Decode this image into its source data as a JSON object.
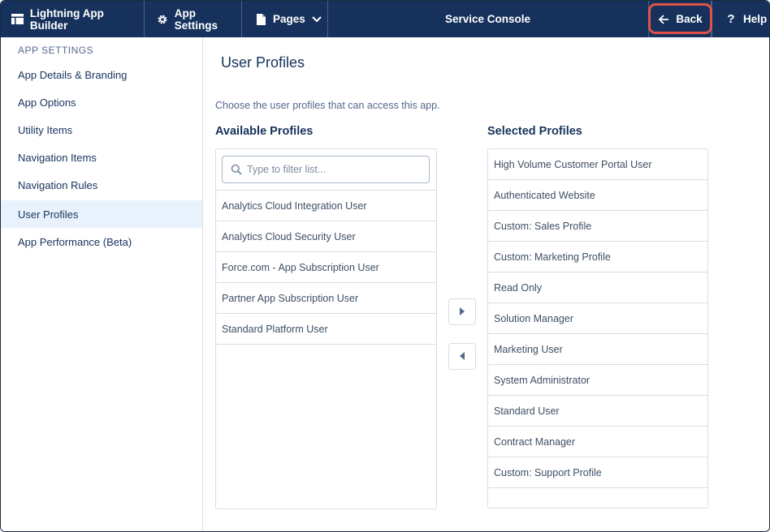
{
  "topbar": {
    "brand": "Lightning App Builder",
    "settings": "App Settings",
    "pages": "Pages",
    "app_name": "Service Console",
    "back": "Back",
    "help": "Help"
  },
  "icons": {
    "brand": "app-builder-icon",
    "settings": "gear-icon",
    "pages": "page-icon",
    "pages_menu": "chevron-down-icon",
    "back": "arrow-left-icon",
    "help": "question-icon",
    "filter": "search-icon",
    "move_right": "triangle-right-icon",
    "move_left": "triangle-left-icon"
  },
  "colors": {
    "topbar_bg": "#16325c",
    "active_item_bg": "#e8f2fc",
    "highlight_ring": "#e2514b"
  },
  "sidebar": {
    "heading": "APP SETTINGS",
    "items": [
      {
        "label": "App Details & Branding"
      },
      {
        "label": "App Options"
      },
      {
        "label": "Utility Items"
      },
      {
        "label": "Navigation Items"
      },
      {
        "label": "Navigation Rules"
      },
      {
        "label": "User Profiles",
        "active": true
      },
      {
        "label": "App Performance (Beta)"
      }
    ]
  },
  "main": {
    "title": "User Profiles",
    "description": "Choose the user profiles that can access this app.",
    "available": {
      "title": "Available Profiles",
      "filter_placeholder": "Type to filter list...",
      "items": [
        "Analytics Cloud Integration User",
        "Analytics Cloud Security User",
        "Force.com - App Subscription User",
        "Partner App Subscription User",
        "Standard Platform User"
      ]
    },
    "selected": {
      "title": "Selected Profiles",
      "items": [
        "High Volume Customer Portal User",
        "Authenticated Website",
        "Custom: Sales Profile",
        "Custom: Marketing Profile",
        "Read Only",
        "Solution Manager",
        "Marketing User",
        "System Administrator",
        "Standard User",
        "Contract Manager",
        "Custom: Support Profile"
      ]
    }
  }
}
